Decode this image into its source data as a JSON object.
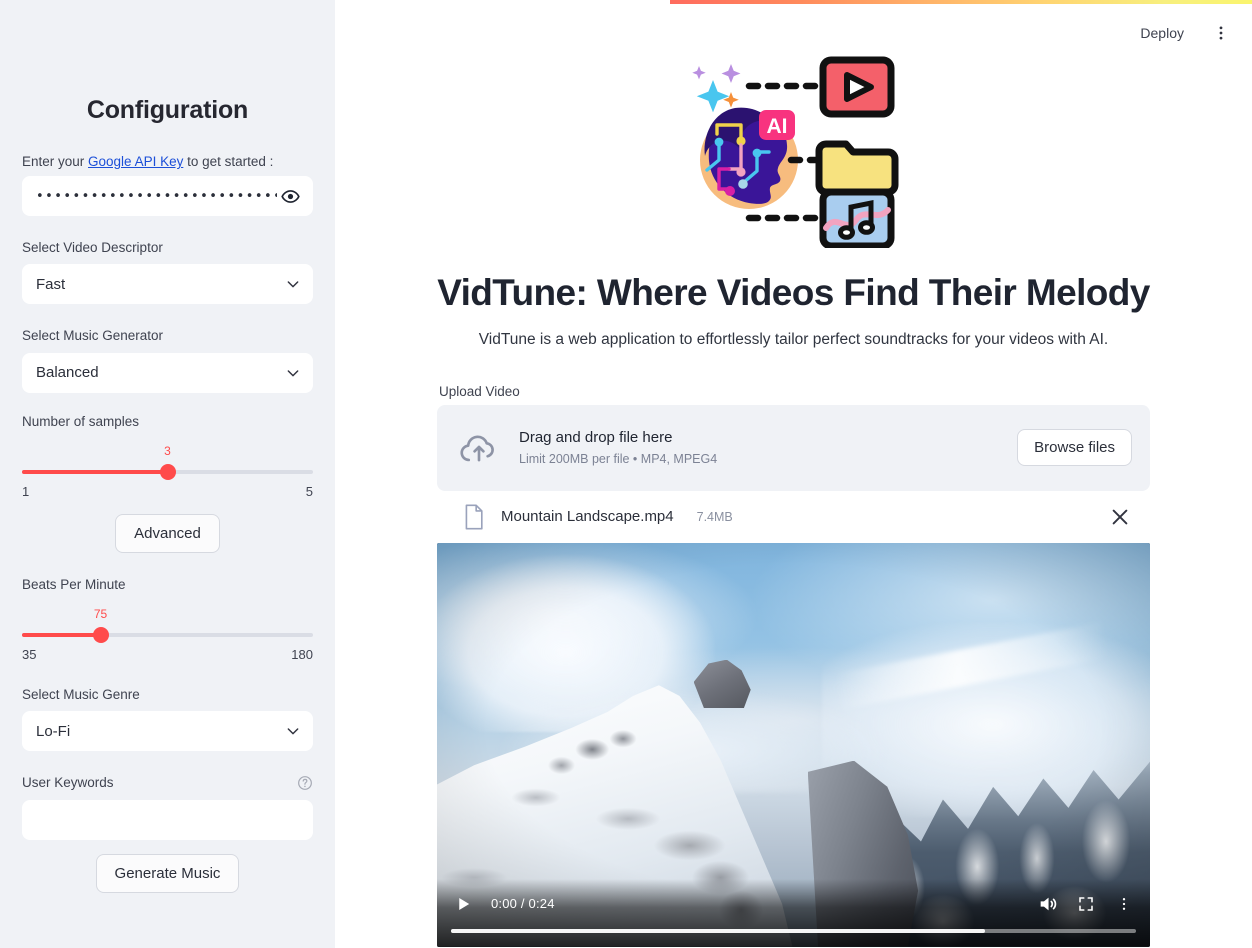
{
  "sidebar": {
    "title": "Configuration",
    "api_key": {
      "prefix": "Enter your ",
      "link_text": "Google API Key",
      "suffix": " to get started :",
      "masked_value": "•••••••••••••••••••••••••••••••••••••••••••••••",
      "toggle_icon": "eye-icon"
    },
    "video_descriptor": {
      "label": "Select Video Descriptor",
      "value": "Fast"
    },
    "music_generator": {
      "label": "Select Music Generator",
      "value": "Balanced"
    },
    "samples": {
      "label": "Number of samples",
      "value": "3",
      "min": "1",
      "max": "5",
      "percent": 50
    },
    "advanced_button": "Advanced",
    "bpm": {
      "label": "Beats Per Minute",
      "value": "75",
      "min": "35",
      "max": "180",
      "percent": 27
    },
    "music_genre": {
      "label": "Select Music Genre",
      "value": "Lo-Fi"
    },
    "keywords": {
      "label": "User Keywords",
      "value": "",
      "placeholder": ""
    },
    "generate_button": "Generate Music"
  },
  "topbar": {
    "deploy_label": "Deploy",
    "menu_icon": "kebab-menu-icon"
  },
  "hero": {
    "title": "VidTune: Where Videos Find Their Melody",
    "subtitle": "VidTune is a web application to effortlessly tailor perfect soundtracks for your videos with AI.",
    "logo_badge": "AI"
  },
  "upload": {
    "label": "Upload Video",
    "drop_title": "Drag and drop file here",
    "drop_limits": "Limit 200MB per file • MP4, MPEG4",
    "browse_label": "Browse files"
  },
  "file": {
    "name": "Mountain Landscape.mp4",
    "size": "7.4MB"
  },
  "player": {
    "time": "0:00 / 0:24",
    "play_icon": "play-icon",
    "volume_icon": "volume-icon",
    "fullscreen_icon": "fullscreen-icon",
    "menu_icon": "kebab-menu-icon",
    "buffered_percent": 78
  },
  "colors": {
    "accent_red": "#ff4b4b",
    "sidebar_bg": "#f0f2f6",
    "link_blue": "#1c4fd8",
    "strip_start": "#ff6b5e",
    "strip_end": "#faf56e"
  }
}
